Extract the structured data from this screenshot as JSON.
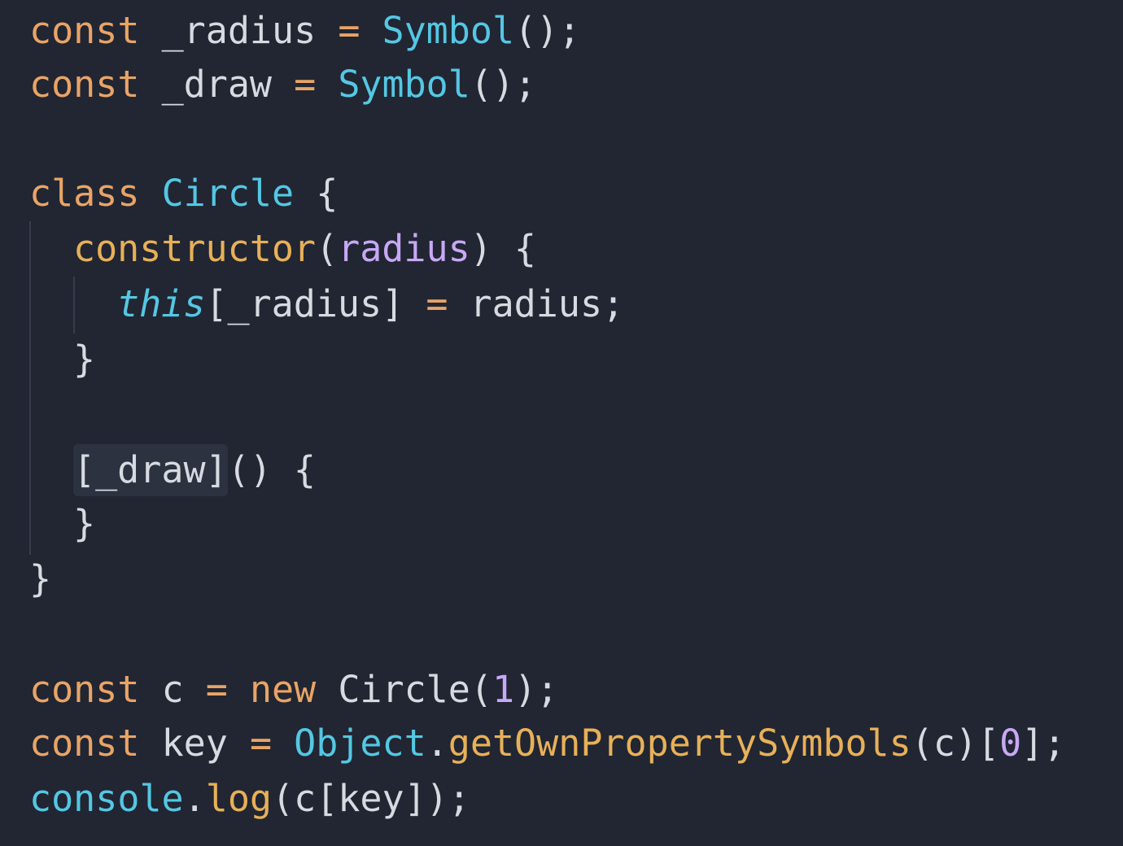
{
  "theme": {
    "background": "#212632",
    "keyword": "#e9a466",
    "type": "#54c7e3",
    "text": "#d7dae0",
    "parameter": "#c8a8f5",
    "function": "#e8b058"
  },
  "code": {
    "line1": {
      "kw": "const",
      "name": "_radius",
      "op": "=",
      "fn": "Symbol",
      "rest": "();"
    },
    "line2": {
      "kw": "const",
      "name": "_draw",
      "op": "=",
      "fn": "Symbol",
      "rest": "();"
    },
    "line4": {
      "kw": "class",
      "name": "Circle",
      "brace": "{"
    },
    "line5": {
      "method": "constructor",
      "open": "(",
      "param": "radius",
      "close": ") {"
    },
    "line6": {
      "this": "this",
      "access": "[_radius]",
      "op": "=",
      "value": "radius;"
    },
    "line7": {
      "brace": "}"
    },
    "line9": {
      "method": "[_draw]",
      "rest": "() {"
    },
    "line10": {
      "brace": "}"
    },
    "line11": {
      "brace": "}"
    },
    "line13": {
      "kw": "const",
      "name": "c",
      "op": "=",
      "kw2": "new",
      "cls": "Circle",
      "open": "(",
      "num": "1",
      "close": ");"
    },
    "line14": {
      "kw": "const",
      "name": "key",
      "op": "=",
      "obj": "Object",
      "dot": ".",
      "fn": "getOwnPropertySymbols",
      "args": "(c)",
      "open": "[",
      "num": "0",
      "close": "];"
    },
    "line15": {
      "obj": "console",
      "dot": ".",
      "fn": "log",
      "rest": "(c[key]);"
    }
  }
}
